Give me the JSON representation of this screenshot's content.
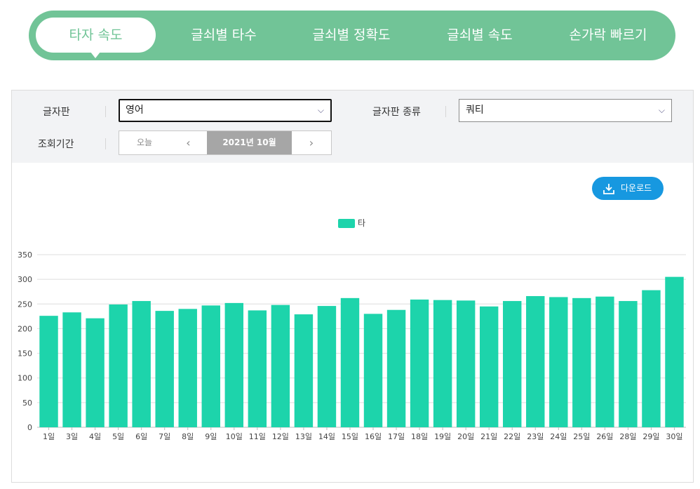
{
  "tabs": [
    {
      "label": "타자 속도",
      "active": true
    },
    {
      "label": "글쇠별 타수",
      "active": false
    },
    {
      "label": "글쇠별 정확도",
      "active": false
    },
    {
      "label": "글쇠별 속도",
      "active": false
    },
    {
      "label": "손가락 빠르기",
      "active": false
    }
  ],
  "filters": {
    "keyboard_label": "글자판",
    "keyboard_value": "영어",
    "layout_label": "글자판 종류",
    "layout_value": "쿼티",
    "period_label": "조회기간",
    "today_label": "오늘",
    "prev_icon": "‹",
    "current_period": "2021년 10월",
    "next_icon": "›"
  },
  "download_label": "다운로드",
  "colors": {
    "accent": "#71c497",
    "bar": "#1dd4ab",
    "download": "#1798e0"
  },
  "chart_data": {
    "type": "bar",
    "categories": [
      "1일",
      "3일",
      "4일",
      "5일",
      "6일",
      "7일",
      "8일",
      "9일",
      "10일",
      "11일",
      "12일",
      "13일",
      "14일",
      "15일",
      "16일",
      "17일",
      "18일",
      "19일",
      "20일",
      "21일",
      "22일",
      "23일",
      "24일",
      "25일",
      "26일",
      "28일",
      "29일",
      "30일"
    ],
    "series": [
      {
        "name": "타",
        "values": [
          226,
          233,
          221,
          249,
          256,
          236,
          240,
          247,
          252,
          237,
          248,
          229,
          246,
          262,
          230,
          238,
          259,
          258,
          257,
          245,
          256,
          266,
          264,
          262,
          265,
          256,
          278,
          305
        ]
      }
    ],
    "ylim": [
      0,
      350
    ],
    "yticks": [
      0,
      50,
      100,
      150,
      200,
      250,
      300,
      350
    ],
    "grid": true,
    "legend": "top-center"
  }
}
